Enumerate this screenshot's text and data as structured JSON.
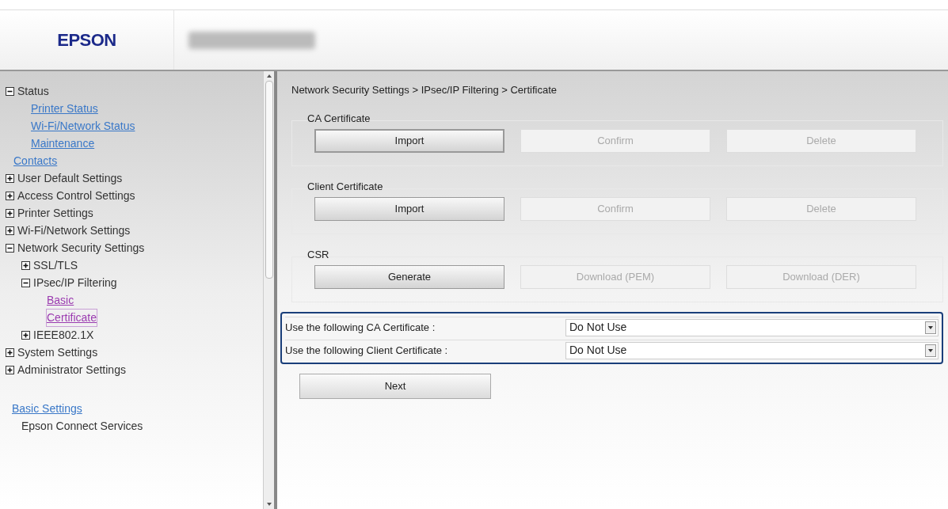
{
  "header": {
    "logo": "EPSON"
  },
  "sidebar": {
    "tree": [
      {
        "kind": "group",
        "label": "Status",
        "expanded": true,
        "children": [
          {
            "kind": "link",
            "label": "Printer Status",
            "visited": false,
            "selected": false
          },
          {
            "kind": "link",
            "label": "Wi-Fi/Network Status",
            "visited": false,
            "selected": false
          },
          {
            "kind": "link",
            "label": "Maintenance",
            "visited": false,
            "selected": false
          }
        ]
      },
      {
        "kind": "link",
        "label": "Contacts",
        "visited": false,
        "selected": false
      },
      {
        "kind": "group",
        "label": "User Default Settings",
        "expanded": false
      },
      {
        "kind": "group",
        "label": "Access Control Settings",
        "expanded": false
      },
      {
        "kind": "group",
        "label": "Printer Settings",
        "expanded": false
      },
      {
        "kind": "group",
        "label": "Wi-Fi/Network Settings",
        "expanded": false
      },
      {
        "kind": "group",
        "label": "Network Security Settings",
        "expanded": true,
        "children": [
          {
            "kind": "group",
            "label": "SSL/TLS",
            "expanded": false
          },
          {
            "kind": "group",
            "label": "IPsec/IP Filtering",
            "expanded": true,
            "children": [
              {
                "kind": "link",
                "label": "Basic",
                "visited": true,
                "selected": false
              },
              {
                "kind": "link",
                "label": "Certificate",
                "visited": true,
                "selected": true
              }
            ]
          },
          {
            "kind": "group",
            "label": "IEEE802.1X",
            "expanded": false
          }
        ]
      },
      {
        "kind": "group",
        "label": "System Settings",
        "expanded": false
      },
      {
        "kind": "group",
        "label": "Administrator Settings",
        "expanded": false
      }
    ],
    "footer_links": [
      {
        "kind": "link",
        "label": "Basic Settings"
      },
      {
        "kind": "text",
        "label": "Epson Connect Services"
      }
    ]
  },
  "breadcrumb": "Network Security Settings > IPsec/IP Filtering > Certificate",
  "sections": [
    {
      "title": "CA Certificate",
      "buttons": [
        {
          "label": "Import",
          "disabled": false,
          "focused": true
        },
        {
          "label": "Confirm",
          "disabled": true,
          "focused": false
        },
        {
          "label": "Delete",
          "disabled": true,
          "focused": false
        }
      ]
    },
    {
      "title": "Client Certificate",
      "buttons": [
        {
          "label": "Import",
          "disabled": false,
          "focused": false
        },
        {
          "label": "Confirm",
          "disabled": true,
          "focused": false
        },
        {
          "label": "Delete",
          "disabled": true,
          "focused": false
        }
      ]
    },
    {
      "title": "CSR",
      "buttons": [
        {
          "label": "Generate",
          "disabled": false,
          "focused": false
        },
        {
          "label": "Download (PEM)",
          "disabled": true,
          "focused": false
        },
        {
          "label": "Download (DER)",
          "disabled": true,
          "focused": false
        }
      ]
    }
  ],
  "settings": [
    {
      "label": "Use the following CA Certificate :",
      "value": "Do Not Use"
    },
    {
      "label": "Use the following Client Certificate :",
      "value": "Do Not Use"
    }
  ],
  "next_button": "Next"
}
